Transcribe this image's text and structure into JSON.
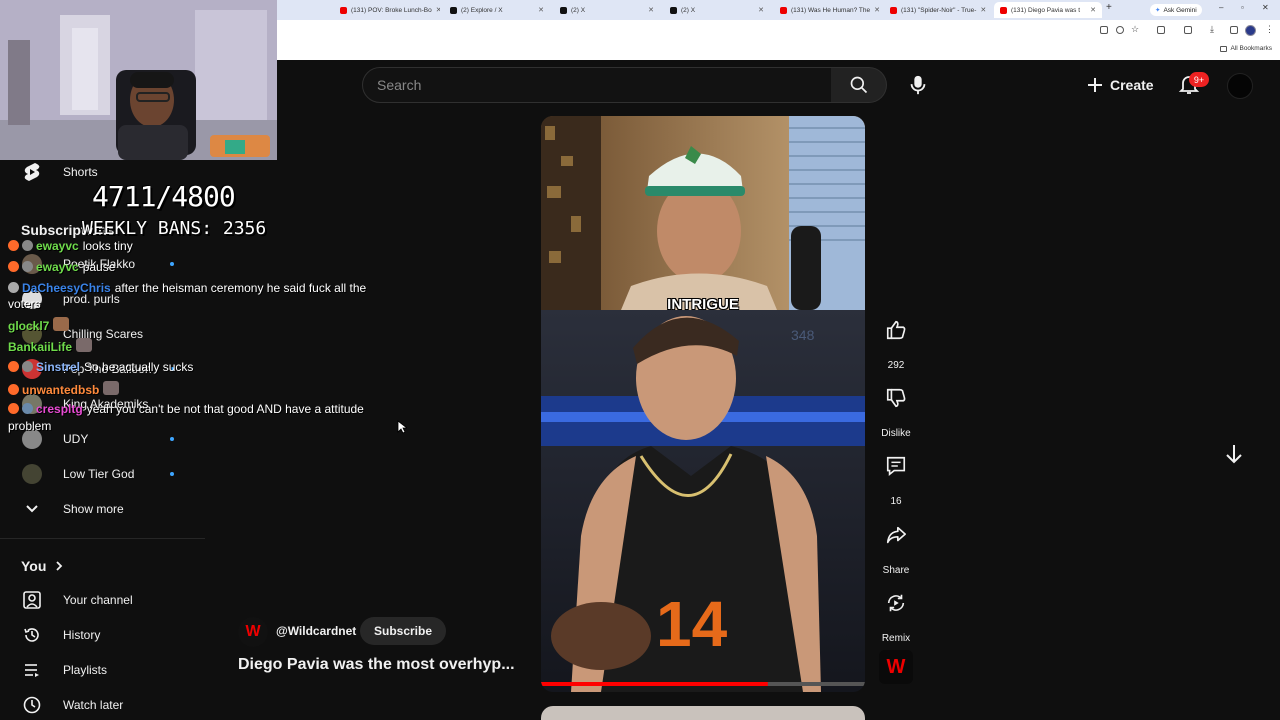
{
  "browser": {
    "tabs": [
      {
        "title": "(131) POV: Broke Lunch-Bo",
        "favicon": "youtube-icon"
      },
      {
        "title": "(2) Explore / X",
        "favicon": "x-icon"
      },
      {
        "title": "(2) X",
        "favicon": "x-icon"
      },
      {
        "title": "(2) X",
        "favicon": "x-icon"
      },
      {
        "title": "(131) Was He Human? The",
        "favicon": "youtube-icon"
      },
      {
        "title": "(131) \"Spider-Noir\" - True-",
        "favicon": "youtube-icon"
      },
      {
        "title": "(131) Diego Pavia was t",
        "favicon": "youtube-icon"
      }
    ],
    "gemini_label": "Ask Gemini",
    "bookmarks_label": "All Bookmarks"
  },
  "header": {
    "search_placeholder": "Search",
    "create_label": "Create",
    "notification_count": "9+"
  },
  "sidebar": {
    "shorts_label": "Shorts",
    "subscriptions_label": "Subscriptions",
    "channels": [
      {
        "name": "Poetik Flakko"
      },
      {
        "name": "prod. purls"
      },
      {
        "name": "Chilling Scares"
      },
      {
        "name": "Pop The Balloon"
      },
      {
        "name": "King Akademiks"
      },
      {
        "name": "UDY"
      },
      {
        "name": "Low Tier God"
      }
    ],
    "show_more_label": "Show more",
    "you_label": "You",
    "you_items": [
      {
        "label": "Your channel",
        "icon": "account-icon"
      },
      {
        "label": "History",
        "icon": "history-icon"
      },
      {
        "label": "Playlists",
        "icon": "playlist-icon"
      },
      {
        "label": "Watch later",
        "icon": "clock-icon"
      }
    ]
  },
  "overlay": {
    "counter": "4711/4800",
    "weekly_bans": "WEEKLY BANS: 2356",
    "chat": [
      {
        "user": "ewayvc",
        "message": "looks tiny",
        "color": "#6fdc4b"
      },
      {
        "user": "ewayvc",
        "message": "pause",
        "color": "#6fdc4b"
      },
      {
        "user": "DaCheesyChris",
        "message": "after the heisman ceremony he said fuck all the",
        "cont": "voters",
        "color": "#3a83e8"
      },
      {
        "user": "glockl7",
        "message": "",
        "color": "#6fdc4b"
      },
      {
        "user": "BankaiiLife",
        "message": "",
        "color": "#6fdc4b"
      },
      {
        "user": "Sinstrel",
        "message": "So he actually sucks",
        "color": "#8ab4f8"
      },
      {
        "user": "unwantedbsb",
        "message": "",
        "color": "#ff8a3c"
      },
      {
        "user": "crespltg",
        "message": "yeah you can't be not that good AND have a attitude",
        "cont": "problem",
        "color": "#e84bd3"
      }
    ]
  },
  "short": {
    "caption": "INTRIGUE",
    "channel": "@Wildcardnet",
    "subscribe_label": "Subscribe",
    "title": "Diego Pavia was the most overhyp...",
    "jersey_number": "14",
    "progress": 0.7
  },
  "actions": {
    "like_count": "292",
    "dislike_label": "Dislike",
    "comment_count": "16",
    "share_label": "Share",
    "remix_label": "Remix"
  },
  "colors": {
    "background": "#0f0f0f",
    "accent_red": "#ff0000",
    "badge_red": "#e22222",
    "link_blue": "#3ea6ff"
  }
}
